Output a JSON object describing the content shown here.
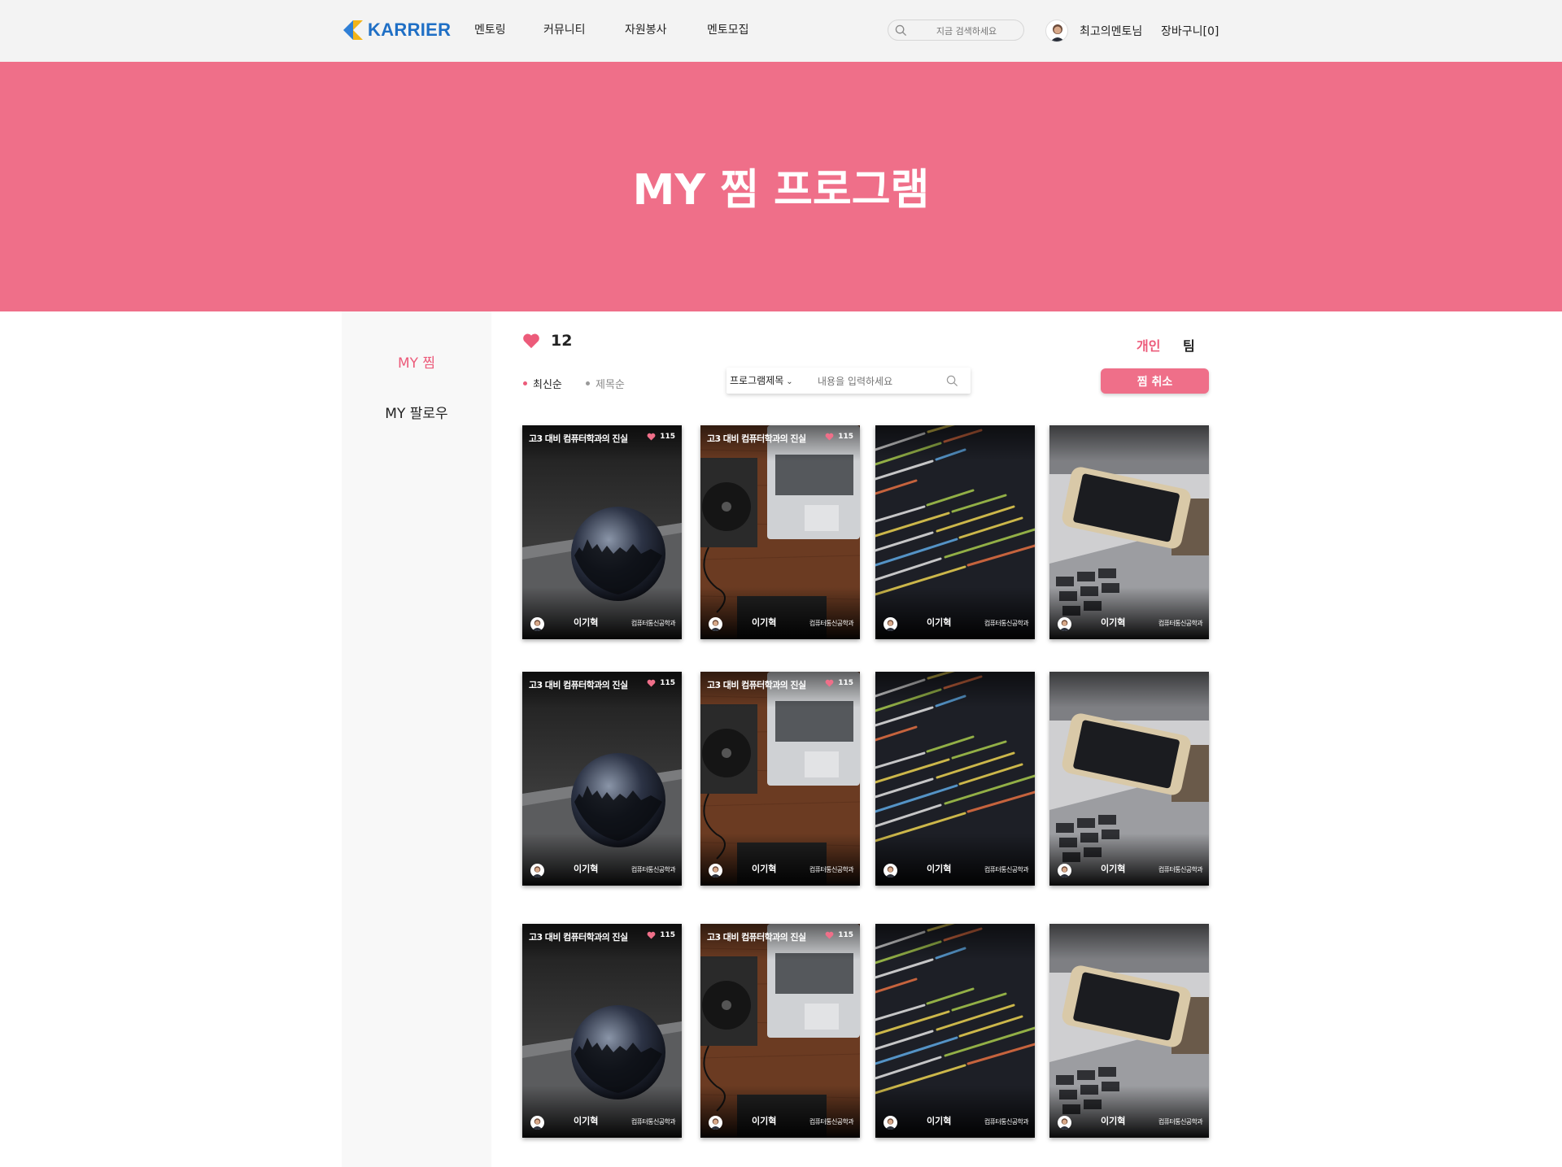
{
  "header": {
    "logo_text": "KARRIER",
    "nav": [
      "멘토링",
      "커뮤니티",
      "자원봉사",
      "멘토모집"
    ],
    "search_placeholder": "지금 검색하세요",
    "user_name": "최고의멘토님",
    "cart": "장바구니[0]"
  },
  "hero": {
    "title": "MY 찜 프로그램"
  },
  "sidebar": {
    "items": [
      "MY 찜",
      "MY 팔로우"
    ]
  },
  "main": {
    "like_count": "12",
    "tabs": [
      "개인",
      "팀"
    ],
    "sort": [
      "최신순",
      "제목순"
    ],
    "filter_select": "프로그램제목",
    "filter_placeholder": "내용을 입력하세요",
    "cancel_button": "찜 취소"
  },
  "cards": [
    {
      "title": "고3 대비 컴퓨터학과의 진실",
      "likes": "115",
      "author": "이기혁",
      "dept": "컴퓨터통신공학과",
      "image": "chrome-sphere"
    },
    {
      "title": "고3 대비 컴퓨터학과의 진실",
      "likes": "115",
      "author": "이기혁",
      "dept": "컴퓨터통신공학과",
      "image": "laptop-turntable"
    },
    {
      "title": "",
      "likes": "",
      "author": "이기혁",
      "dept": "컴퓨터통신공학과",
      "image": "code-screen"
    },
    {
      "title": "",
      "likes": "",
      "author": "이기혁",
      "dept": "컴퓨터통신공학과",
      "image": "phone-laptop"
    },
    {
      "title": "고3 대비 컴퓨터학과의 진실",
      "likes": "115",
      "author": "이기혁",
      "dept": "컴퓨터통신공학과",
      "image": "chrome-sphere"
    },
    {
      "title": "고3 대비 컴퓨터학과의 진실",
      "likes": "115",
      "author": "이기혁",
      "dept": "컴퓨터통신공학과",
      "image": "laptop-turntable"
    },
    {
      "title": "",
      "likes": "",
      "author": "이기혁",
      "dept": "컴퓨터통신공학과",
      "image": "code-screen"
    },
    {
      "title": "",
      "likes": "",
      "author": "이기혁",
      "dept": "컴퓨터통신공학과",
      "image": "phone-laptop"
    },
    {
      "title": "고3 대비 컴퓨터학과의 진실",
      "likes": "115",
      "author": "이기혁",
      "dept": "컴퓨터통신공학과",
      "image": "chrome-sphere"
    },
    {
      "title": "고3 대비 컴퓨터학과의 진실",
      "likes": "115",
      "author": "이기혁",
      "dept": "컴퓨터통신공학과",
      "image": "laptop-turntable"
    },
    {
      "title": "",
      "likes": "",
      "author": "이기혁",
      "dept": "컴퓨터통신공학과",
      "image": "code-screen"
    },
    {
      "title": "",
      "likes": "",
      "author": "이기혁",
      "dept": "컴퓨터통신공학과",
      "image": "phone-laptop"
    }
  ],
  "colors": {
    "accent": "#ef6f89",
    "accent_text": "#ec5b7a",
    "logo": "#1f6fc5"
  }
}
